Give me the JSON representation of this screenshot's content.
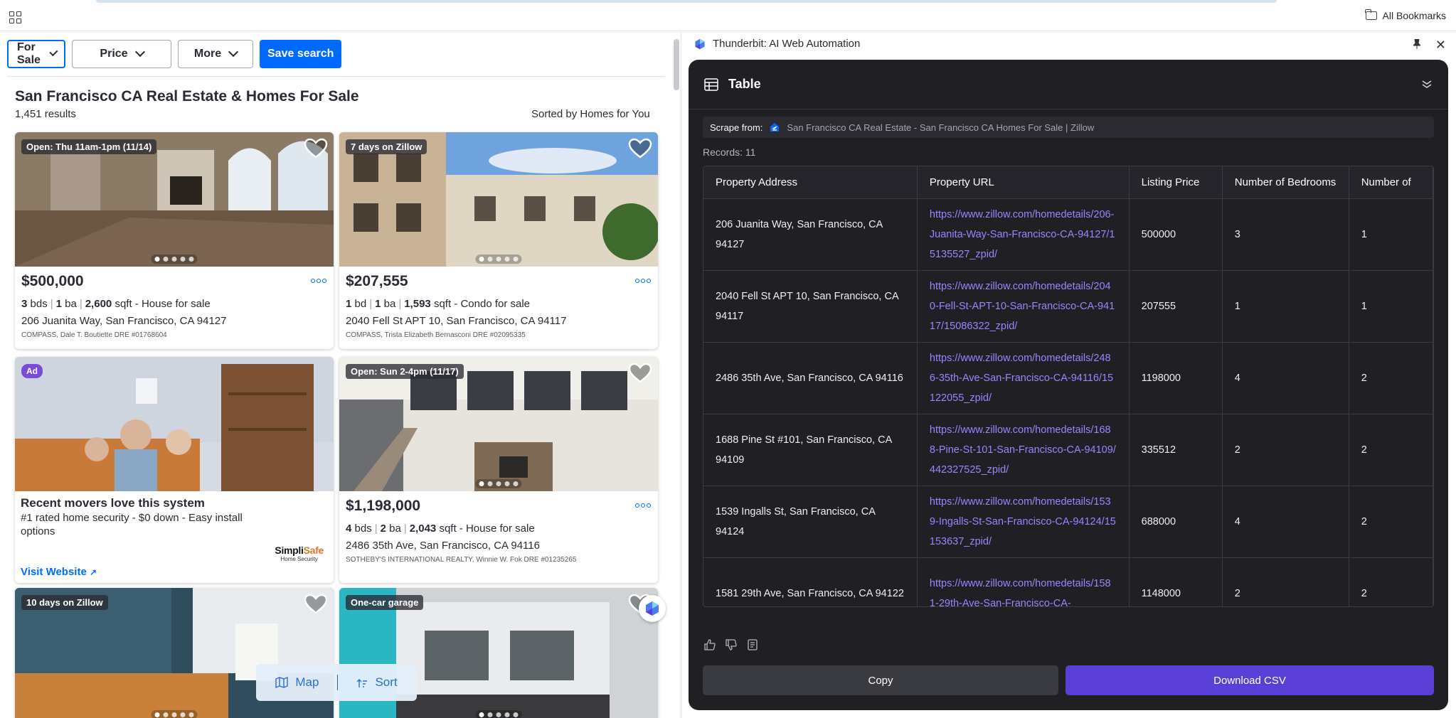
{
  "browser": {
    "bookmarks_label": "All Bookmarks"
  },
  "filters": {
    "for_sale": "For Sale",
    "price": "Price",
    "more": "More",
    "save_search": "Save search"
  },
  "listing": {
    "title": "San Francisco CA Real Estate & Homes For Sale",
    "results": "1,451 results",
    "sorted": "Sorted by Homes for You"
  },
  "cards": [
    {
      "badge": "Open: Thu 11am-1pm (11/14)",
      "price": "$500,000",
      "beds": "3",
      "beds_unit": "bds",
      "baths": "1",
      "baths_unit": "ba",
      "sqft": "2,600",
      "sqft_unit": "sqft",
      "type": "- House for sale",
      "address": "206 Juanita Way, San Francisco, CA 94127",
      "broker": "COMPASS, Dale T. Boutiette DRE #01768604"
    },
    {
      "badge": "7 days on Zillow",
      "price": "$207,555",
      "beds": "1",
      "beds_unit": "bd",
      "baths": "1",
      "baths_unit": "ba",
      "sqft": "1,593",
      "sqft_unit": "sqft",
      "type": "- Condo for sale",
      "address": "2040 Fell St APT 10, San Francisco, CA 94117",
      "broker": "COMPASS, Trista Elizabeth Bernasconi DRE #02095335"
    },
    {
      "badge": "Open: Sun 2-4pm (11/17)",
      "price": "$1,198,000",
      "beds": "4",
      "beds_unit": "bds",
      "baths": "2",
      "baths_unit": "ba",
      "sqft": "2,043",
      "sqft_unit": "sqft",
      "type": "- House for sale",
      "address": "2486 35th Ave, San Francisco, CA 94116",
      "broker": "SOTHEBY'S INTERNATIONAL REALTY, Winnie W. Fok DRE #01235265"
    },
    {
      "badge": "10 days on Zillow"
    },
    {
      "badge": "One-car garage"
    }
  ],
  "ad": {
    "badge": "Ad",
    "title": "Recent movers love this system",
    "text": "#1 rated home security - $0 down - Easy install options",
    "link": "Visit Website",
    "brand_a": "Simpli",
    "brand_b": "Safe",
    "brand_sub": "Home Security"
  },
  "mapsort": {
    "map": "Map",
    "sort": "Sort"
  },
  "thunderbit": {
    "header": "Thunderbit: AI Web Automation",
    "panel_title": "Table",
    "scrape_label": "Scrape from:",
    "scrape_source": "San Francisco CA Real Estate - San Francisco CA Homes For Sale | Zillow",
    "records": "Records: 11",
    "columns": [
      "Property Address",
      "Property URL",
      "Listing Price",
      "Number of Bedrooms",
      "Number of"
    ],
    "rows": [
      [
        "206 Juanita Way, San Francisco, CA 94127",
        "https://www.zillow.com/homedetails/206-Juanita-Way-San-Francisco-CA-94127/15135527_zpid/",
        "500000",
        "3",
        "1"
      ],
      [
        "2040 Fell St APT 10, San Francisco, CA 94117",
        "https://www.zillow.com/homedetails/2040-Fell-St-APT-10-San-Francisco-CA-94117/15086322_zpid/",
        "207555",
        "1",
        "1"
      ],
      [
        "2486 35th Ave, San Francisco, CA 94116",
        "https://www.zillow.com/homedetails/2486-35th-Ave-San-Francisco-CA-94116/15122055_zpid/",
        "1198000",
        "4",
        "2"
      ],
      [
        "1688 Pine St #101, San Francisco, CA 94109",
        "https://www.zillow.com/homedetails/1688-Pine-St-101-San-Francisco-CA-94109/442327525_zpid/",
        "335512",
        "2",
        "2"
      ],
      [
        "1539 Ingalls St, San Francisco, CA 94124",
        "https://www.zillow.com/homedetails/1539-Ingalls-St-San-Francisco-CA-94124/15153637_zpid/",
        "688000",
        "4",
        "2"
      ],
      [
        "1581 29th Ave, San Francisco, CA 94122",
        "https://www.zillow.com/homedetails/1581-29th-Ave-San-Francisco-CA-",
        "1148000",
        "2",
        "2"
      ]
    ],
    "copy": "Copy",
    "download": "Download CSV"
  },
  "colors": {
    "zillow_blue": "#006aff",
    "panel_bg": "#1f1f24",
    "accent_purple": "#5a3fd6",
    "link_purple": "#9a86ff"
  }
}
